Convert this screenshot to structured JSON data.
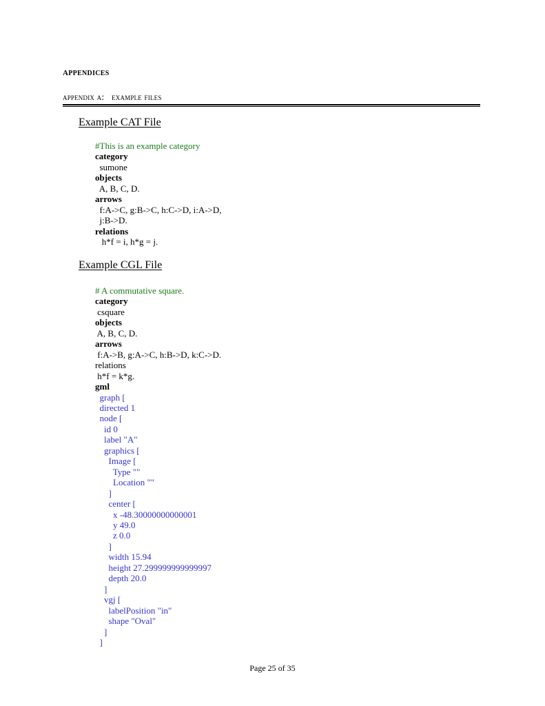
{
  "document": {
    "appendices_heading": "Appendices",
    "appendix_label": "Appendix A:",
    "appendix_title": "Example Files",
    "appendix_line": "Appendix A:   Example Files"
  },
  "sections": {
    "cat": {
      "title": "Example CAT File",
      "lines": [
        {
          "text": "#This is an example category",
          "style": "comment",
          "indent": 0
        },
        {
          "text": "category",
          "style": "key",
          "indent": 0
        },
        {
          "text": "  sumone",
          "style": "plain",
          "indent": 0
        },
        {
          "text": "objects",
          "style": "key",
          "indent": 0
        },
        {
          "text": "  A, B, C, D.",
          "style": "plain",
          "indent": 0
        },
        {
          "text": "arrows",
          "style": "key",
          "indent": 0
        },
        {
          "text": "  f:A->C, g:B->C, h:C->D, i:A->D,",
          "style": "plain",
          "indent": 0
        },
        {
          "text": "  j:B->D.",
          "style": "plain",
          "indent": 0
        },
        {
          "text": "relations",
          "style": "key",
          "indent": 0
        },
        {
          "text": "   h*f = i, h*g = j.",
          "style": "plain",
          "indent": 0
        }
      ]
    },
    "cgl": {
      "title": "Example CGL File",
      "lines": [
        {
          "text": "# A commutative square.",
          "style": "comment",
          "indent": 0
        },
        {
          "text": "category",
          "style": "key",
          "indent": 0
        },
        {
          "text": " csquare",
          "style": "plain",
          "indent": 0
        },
        {
          "text": "objects",
          "style": "key",
          "indent": 0
        },
        {
          "text": " A, B, C, D.",
          "style": "plain",
          "indent": 0
        },
        {
          "text": "arrows",
          "style": "key",
          "indent": 0
        },
        {
          "text": " f:A->B, g:A->C, h:B->D, k:C->D.",
          "style": "plain",
          "indent": 0
        },
        {
          "text": "relations",
          "style": "plain",
          "indent": 0
        },
        {
          "text": " h*f = k*g.",
          "style": "plain",
          "indent": 0
        },
        {
          "text": "gml",
          "style": "key",
          "indent": 0
        },
        {
          "text": "  graph [",
          "style": "gml",
          "indent": 0
        },
        {
          "text": "  directed 1",
          "style": "gml",
          "indent": 0
        },
        {
          "text": "  node [",
          "style": "gml",
          "indent": 0
        },
        {
          "text": "    id 0",
          "style": "gml",
          "indent": 0
        },
        {
          "text": "    label \"A\"",
          "style": "gml",
          "indent": 0
        },
        {
          "text": "    graphics [",
          "style": "gml",
          "indent": 0
        },
        {
          "text": "      Image [",
          "style": "gml",
          "indent": 0
        },
        {
          "text": "        Type \"\"",
          "style": "gml",
          "indent": 0
        },
        {
          "text": "        Location \"\"",
          "style": "gml",
          "indent": 0
        },
        {
          "text": "      ]",
          "style": "gml",
          "indent": 0
        },
        {
          "text": "      center [",
          "style": "gml",
          "indent": 0
        },
        {
          "text": "        x -48.30000000000001",
          "style": "gml",
          "indent": 0
        },
        {
          "text": "        y 49.0",
          "style": "gml",
          "indent": 0
        },
        {
          "text": "        z 0.0",
          "style": "gml",
          "indent": 0
        },
        {
          "text": "      ]",
          "style": "gml",
          "indent": 0
        },
        {
          "text": "      width 15.94",
          "style": "gml",
          "indent": 0
        },
        {
          "text": "      height 27.299999999999997",
          "style": "gml",
          "indent": 0
        },
        {
          "text": "      depth 20.0",
          "style": "gml",
          "indent": 0
        },
        {
          "text": "    ]",
          "style": "gml",
          "indent": 0
        },
        {
          "text": "    vgj [",
          "style": "gml",
          "indent": 0
        },
        {
          "text": "      labelPosition \"in\"",
          "style": "gml",
          "indent": 0
        },
        {
          "text": "      shape \"Oval\"",
          "style": "gml",
          "indent": 0
        },
        {
          "text": "    ]",
          "style": "gml",
          "indent": 0
        },
        {
          "text": "  ]",
          "style": "gml",
          "indent": 0
        }
      ]
    }
  },
  "footer": {
    "page_text": "Page 25 of  35",
    "current_page": 25,
    "total_pages": 35
  },
  "colors": {
    "comment_green": "#1a7a1a",
    "gml_blue": "#3333cc",
    "text_black": "#000000",
    "page_background": "#ffffff"
  }
}
